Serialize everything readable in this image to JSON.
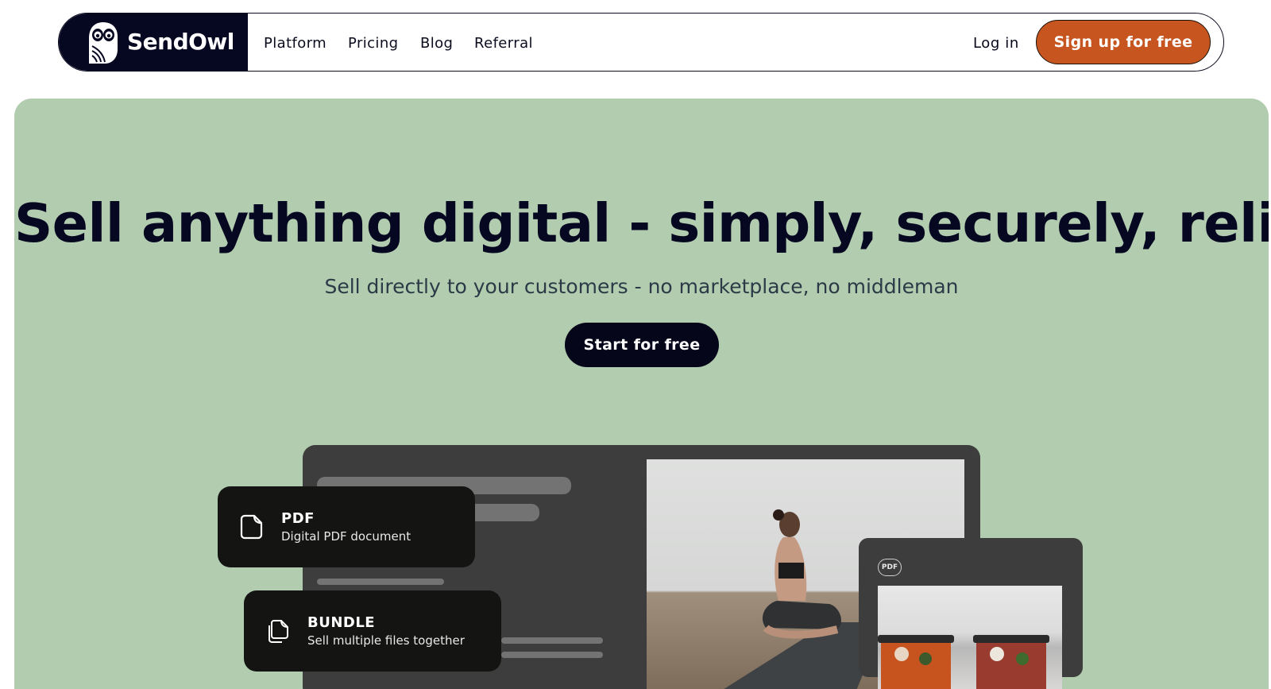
{
  "brand": {
    "name": "SendOwl"
  },
  "nav": {
    "links": [
      "Platform",
      "Pricing",
      "Blog",
      "Referral"
    ],
    "login": "Log in",
    "signup": "Sign up for free"
  },
  "hero": {
    "headline": "Sell anything digital - simply, securely, reliably",
    "subheadline": "Sell directly to your customers - no marketplace, no middleman",
    "cta": "Start for free"
  },
  "cards": [
    {
      "title": "PDF",
      "description": "Digital PDF document",
      "icon": "file-icon"
    },
    {
      "title": "BUNDLE",
      "description": "Sell multiple files together",
      "icon": "stacked-files-icon"
    }
  ],
  "tablet": {
    "badge": "PDF"
  },
  "colors": {
    "navy": "#060720",
    "accent": "#c75520",
    "hero_bg": "#b2ccaf",
    "card_bg": "#141513"
  }
}
